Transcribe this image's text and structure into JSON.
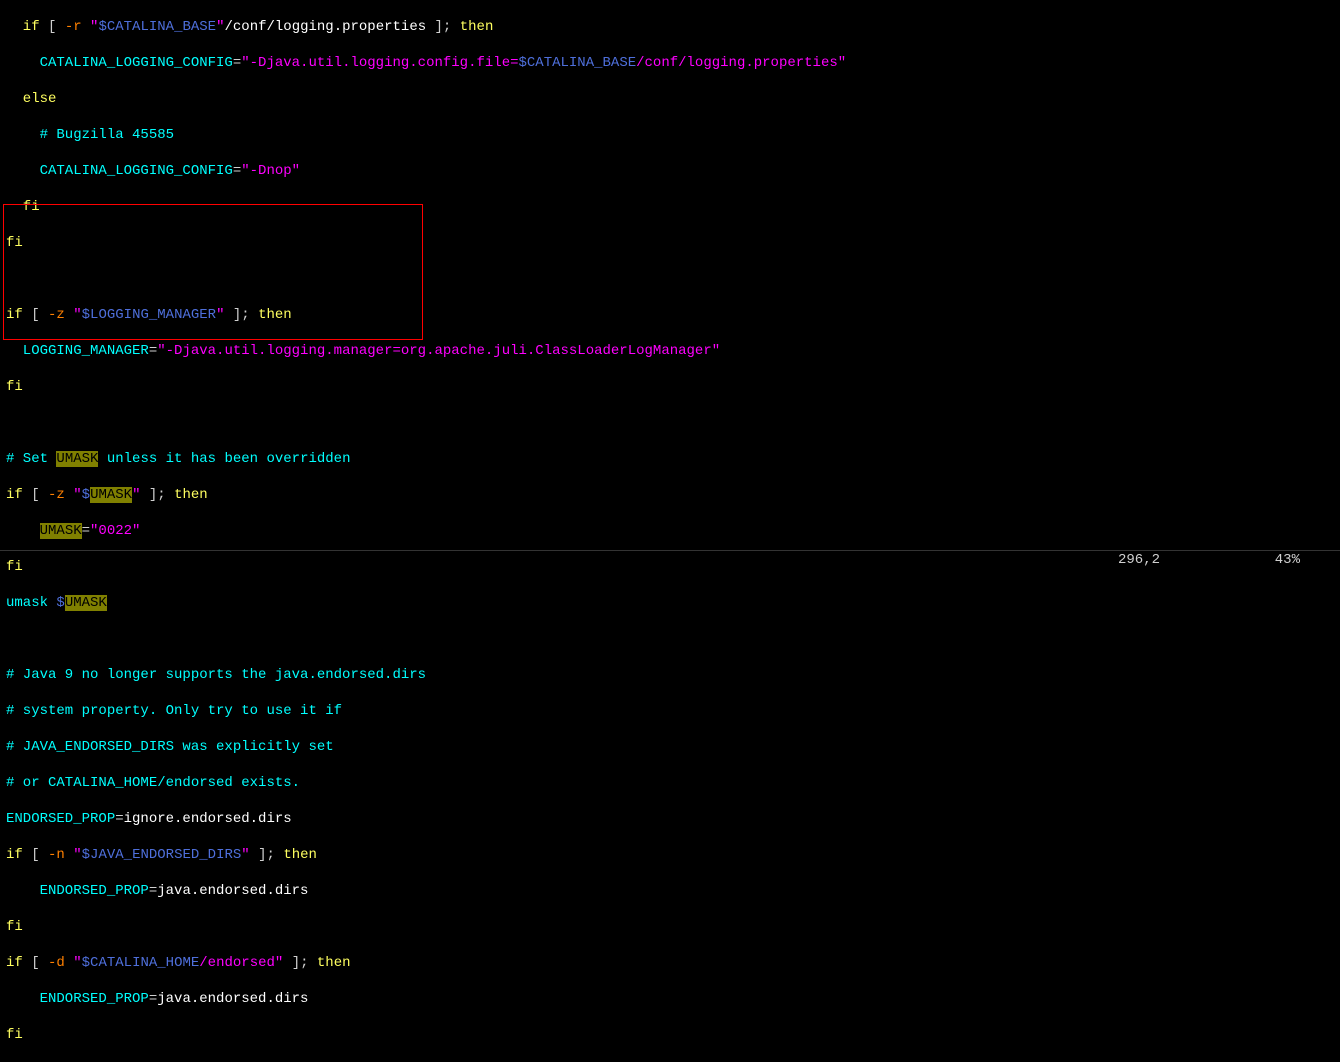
{
  "lines": {
    "l1a": "  if",
    "l1b": " [ ",
    "l1c": "-r",
    "l1d": " \"",
    "l1e": "$CATALINA_BASE",
    "l1f": "\"",
    "l1g": "/conf/logging.properties",
    "l1h": " ]; ",
    "l1i": "then",
    "l2a": "    CATALINA_LOGGING_CONFIG",
    "l2b": "=",
    "l2c": "\"-Djava.util.logging.config.file=",
    "l2d": "$CATALINA_BASE",
    "l2e": "/conf/logging.properties\"",
    "l3a": "  else",
    "l4a": "    # Bugzilla 45585",
    "l5a": "    CATALINA_LOGGING_CONFIG",
    "l5b": "=",
    "l5c": "\"-Dnop\"",
    "l6a": "  fi",
    "l7a": "fi",
    "l8": "",
    "l9a": "if",
    "l9b": " [ ",
    "l9c": "-z",
    "l9d": " \"",
    "l9e": "$LOGGING_MANAGER",
    "l9f": "\"",
    "l9g": " ]; ",
    "l9h": "then",
    "l10a": "  LOGGING_MANAGER",
    "l10b": "=",
    "l10c": "\"-Djava.util.logging.manager=org.apache.juli.ClassLoaderLogManager\"",
    "l11a": "fi",
    "l12": "",
    "l13a": "# Set ",
    "l13b": "UMASK",
    "l13c": " unless it has been overridden",
    "l14a": "if",
    "l14b": " [ ",
    "l14c": "-z",
    "l14d": " \"",
    "l14e": "$",
    "l14f": "UMASK",
    "l14g": "\"",
    "l14h": " ]; ",
    "l14i": "then",
    "l15a": "    ",
    "l15b": "UMASK",
    "l15c": "=",
    "l15d": "\"0022\"",
    "l16a": "fi",
    "l17a": "umask ",
    "l17b": "$",
    "l17c": "UMASK",
    "l18": "",
    "l19a": "# Java 9 no longer supports the java.endorsed.dirs",
    "l20a": "# system property. Only try to use it if",
    "l21a": "# JAVA_ENDORSED_DIRS was explicitly set",
    "l22a": "# or CATALINA_HOME/endorsed exists.",
    "l23a": "ENDORSED_PROP",
    "l23b": "=",
    "l23c": "ignore.endorsed.dirs",
    "l24a": "if",
    "l24b": " [ ",
    "l24c": "-n",
    "l24d": " \"",
    "l24e": "$JAVA_ENDORSED_DIRS",
    "l24f": "\"",
    "l24g": " ]; ",
    "l24h": "then",
    "l25a": "    ENDORSED_PROP",
    "l25b": "=",
    "l25c": "java.endorsed.dirs",
    "l26a": "fi",
    "l27a": "if",
    "l27b": " [ ",
    "l27c": "-d",
    "l27d": " \"",
    "l27e": "$CATALINA_HOME",
    "l27f": "/endorsed\"",
    "l27g": " ]; ",
    "l27h": "then",
    "l28a": "    ENDORSED_PROP",
    "l28b": "=",
    "l28c": "java.endorsed.dirs",
    "l29a": "fi"
  },
  "status": {
    "position": "296,2",
    "percent": "43%"
  }
}
